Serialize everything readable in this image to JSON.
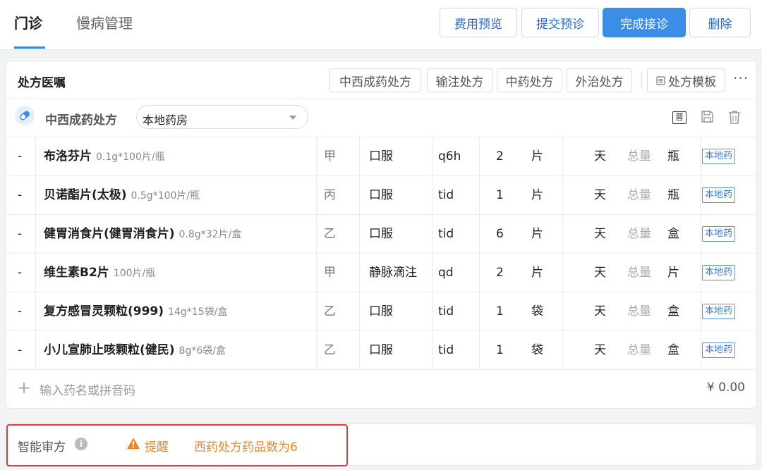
{
  "tabs": [
    {
      "label": "门诊",
      "active": true
    },
    {
      "label": "慢病管理",
      "active": false
    }
  ],
  "actions": {
    "cost_preview": "费用预览",
    "submit_prediag": "提交预诊",
    "finish": "完成接诊",
    "delete": "删除"
  },
  "card": {
    "title": "处方医嘱",
    "chips": [
      "中西成药处方",
      "输注处方",
      "中药处方",
      "外治处方"
    ],
    "template_label": "处方模板",
    "more": "···"
  },
  "prescription": {
    "type": "中西成药处方",
    "pharmacy": "本地药房",
    "pu_badge": "普"
  },
  "columns_hint": {
    "day_unit": "天",
    "total_label": "总量",
    "tag": "本地药"
  },
  "rows": [
    {
      "dash": "-",
      "name": "布洛芬片",
      "spec": "0.1g*100片/瓶",
      "grade": "甲",
      "route": "口服",
      "freq": "q6h",
      "dose": "2",
      "unit": "片",
      "days": "天",
      "total": "总量",
      "total_unit": "瓶",
      "tag": "本地药"
    },
    {
      "dash": "-",
      "name": "贝诺酯片(太极)",
      "spec": "0.5g*100片/瓶",
      "grade": "丙",
      "route": "口服",
      "freq": "tid",
      "dose": "1",
      "unit": "片",
      "days": "天",
      "total": "总量",
      "total_unit": "瓶",
      "tag": "本地药"
    },
    {
      "dash": "-",
      "name": "健胃消食片(健胃消食片)",
      "spec": "0.8g*32片/盒",
      "grade": "乙",
      "route": "口服",
      "freq": "tid",
      "dose": "6",
      "unit": "片",
      "days": "天",
      "total": "总量",
      "total_unit": "盒",
      "tag": "本地药"
    },
    {
      "dash": "-",
      "name": "维生素B2片",
      "spec": "100片/瓶",
      "grade": "甲",
      "route": "静脉滴注",
      "freq": "qd",
      "dose": "2",
      "unit": "片",
      "days": "天",
      "total": "总量",
      "total_unit": "片",
      "tag": "本地药"
    },
    {
      "dash": "-",
      "name": "复方感冒灵颗粒(999)",
      "spec": "14g*15袋/盒",
      "grade": "乙",
      "route": "口服",
      "freq": "tid",
      "dose": "1",
      "unit": "袋",
      "days": "天",
      "total": "总量",
      "total_unit": "盒",
      "tag": "本地药"
    },
    {
      "dash": "-",
      "name": "小儿宣肺止咳颗粒(健民)",
      "spec": "8g*6袋/盒",
      "grade": "乙",
      "route": "口服",
      "freq": "tid",
      "dose": "1",
      "unit": "袋",
      "days": "天",
      "total": "总量",
      "total_unit": "盒",
      "tag": "本地药"
    }
  ],
  "add": {
    "plus": "+",
    "placeholder": "输入药名或拼音码",
    "total": "¥ 0.00"
  },
  "audit": {
    "title": "智能审方",
    "info": "i",
    "level": "提醒",
    "message": "西药处方药品数为6"
  },
  "colors": {
    "primary": "#3a8ee6",
    "warning": "#e8882a",
    "highlight_border": "#e03d3d",
    "tag_blue": "#3b78c9"
  }
}
